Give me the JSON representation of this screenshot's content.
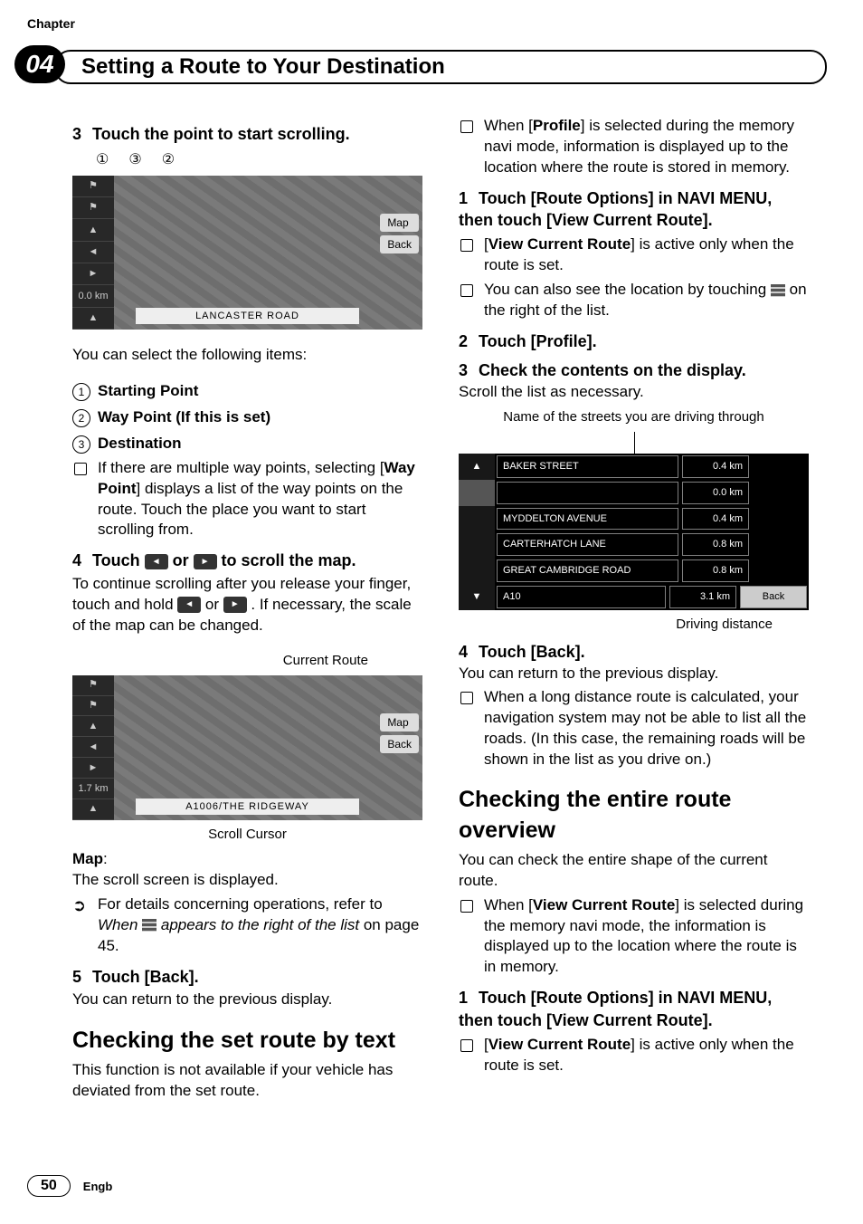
{
  "chapter_label": "Chapter",
  "chapter_number": "04",
  "header_title": "Setting a Route to Your Destination",
  "page_number": "50",
  "lang_label": "Engb",
  "left": {
    "step3_title": "Touch the point to start scrolling.",
    "map1": {
      "callout1": "①",
      "callout2": "②",
      "callout3": "③",
      "side_distance": "0.0 km",
      "bottom_label": "LANCASTER ROAD",
      "btn_map": "Map",
      "btn_back": "Back"
    },
    "select_intro": "You can select the following items:",
    "item1": "Starting Point",
    "item2": "Way Point (If this is set)",
    "item3": "Destination",
    "multi_waypoint_a": "If there are multiple way points, selecting [",
    "multi_waypoint_b": "Way Point",
    "multi_waypoint_c": "] displays a list of the way points on the route. Touch the place you want to start scrolling from.",
    "step4_a": "Touch ",
    "step4_b": " or ",
    "step4_c": " to scroll the map.",
    "scroll_left": "◄",
    "scroll_right": "►",
    "scroll_desc_a": "To continue scrolling after you release your finger, touch and hold ",
    "scroll_desc_b": " or ",
    "scroll_desc_c": " . If necessary, the scale of the map can be changed.",
    "anno_current_route": "Current Route",
    "anno_scroll_cursor": "Scroll Cursor",
    "map2": {
      "side_distance": "1.7 km",
      "bottom_label": "A1006/THE RIDGEWAY",
      "btn_map": "Map",
      "btn_back": "Back"
    },
    "map_label": "Map",
    "map_colon": ":",
    "map_desc": "The scroll screen is displayed.",
    "ref_a": "For details concerning operations, refer to ",
    "ref_b": "When ",
    "ref_c": " appears to the right of the list",
    "ref_d": " on page 45.",
    "step5_title": "Touch [Back].",
    "step5_desc": "You can return to the previous display.",
    "h2_check_text": "Checking the set route by text",
    "check_text_desc": "This function is not available if your vehicle has deviated from the set route."
  },
  "right": {
    "profile_note_a": "When [",
    "profile_note_b": "Profile",
    "profile_note_c": "] is selected during the memory navi mode, information is displayed up to the location where the route is stored in memory.",
    "r_step1_title": "Touch [Route Options] in NAVI MENU, then touch [View Current Route].",
    "r_step1_b1_a": "[",
    "r_step1_b1_b": "View Current Route",
    "r_step1_b1_c": "] is active only when the route is set.",
    "r_step1_b2_a": "You can also see the location by touching ",
    "r_step1_b2_b": " on the right of the list.",
    "r_step2_title": "Touch [Profile].",
    "r_step3_title": "Check the contents on the display.",
    "r_step3_desc": "Scroll the list as necessary.",
    "anno_streets": "Name of the streets you are driving through",
    "anno_driving": "Driving distance",
    "profile_rows": {
      "r0_name": "BAKER STREET",
      "r0_dist": "0.4 km",
      "r1_name": "",
      "r1_dist": "0.0 km",
      "r2_name": "MYDDELTON AVENUE",
      "r2_dist": "0.4 km",
      "r3_name": "CARTERHATCH LANE",
      "r3_dist": "0.8 km",
      "r4_name": "GREAT CAMBRIDGE ROAD",
      "r4_dist": "0.8 km",
      "r5_name": "A10",
      "r5_dist": "3.1 km",
      "back": "Back"
    },
    "r_step4_title": "Touch [Back].",
    "r_step4_desc": "You can return to the previous display.",
    "r_step4_b1": "When a long distance route is calculated, your navigation system may not be able to list all the roads. (In this case, the remaining roads will be shown in the list as you drive on.)",
    "h2_overview": "Checking the entire route overview",
    "overview_desc": "You can check the entire shape of the current route.",
    "overview_b1_a": "When [",
    "overview_b1_b": "View Current Route",
    "overview_b1_c": "] is selected during the memory navi mode, the information is displayed up to the location where the route is in memory.",
    "o_step1_title": "Touch [Route Options] in NAVI MENU, then touch [View Current Route].",
    "o_step1_b1_a": "[",
    "o_step1_b1_b": "View Current Route",
    "o_step1_b1_c": "] is active only when the route is set."
  }
}
